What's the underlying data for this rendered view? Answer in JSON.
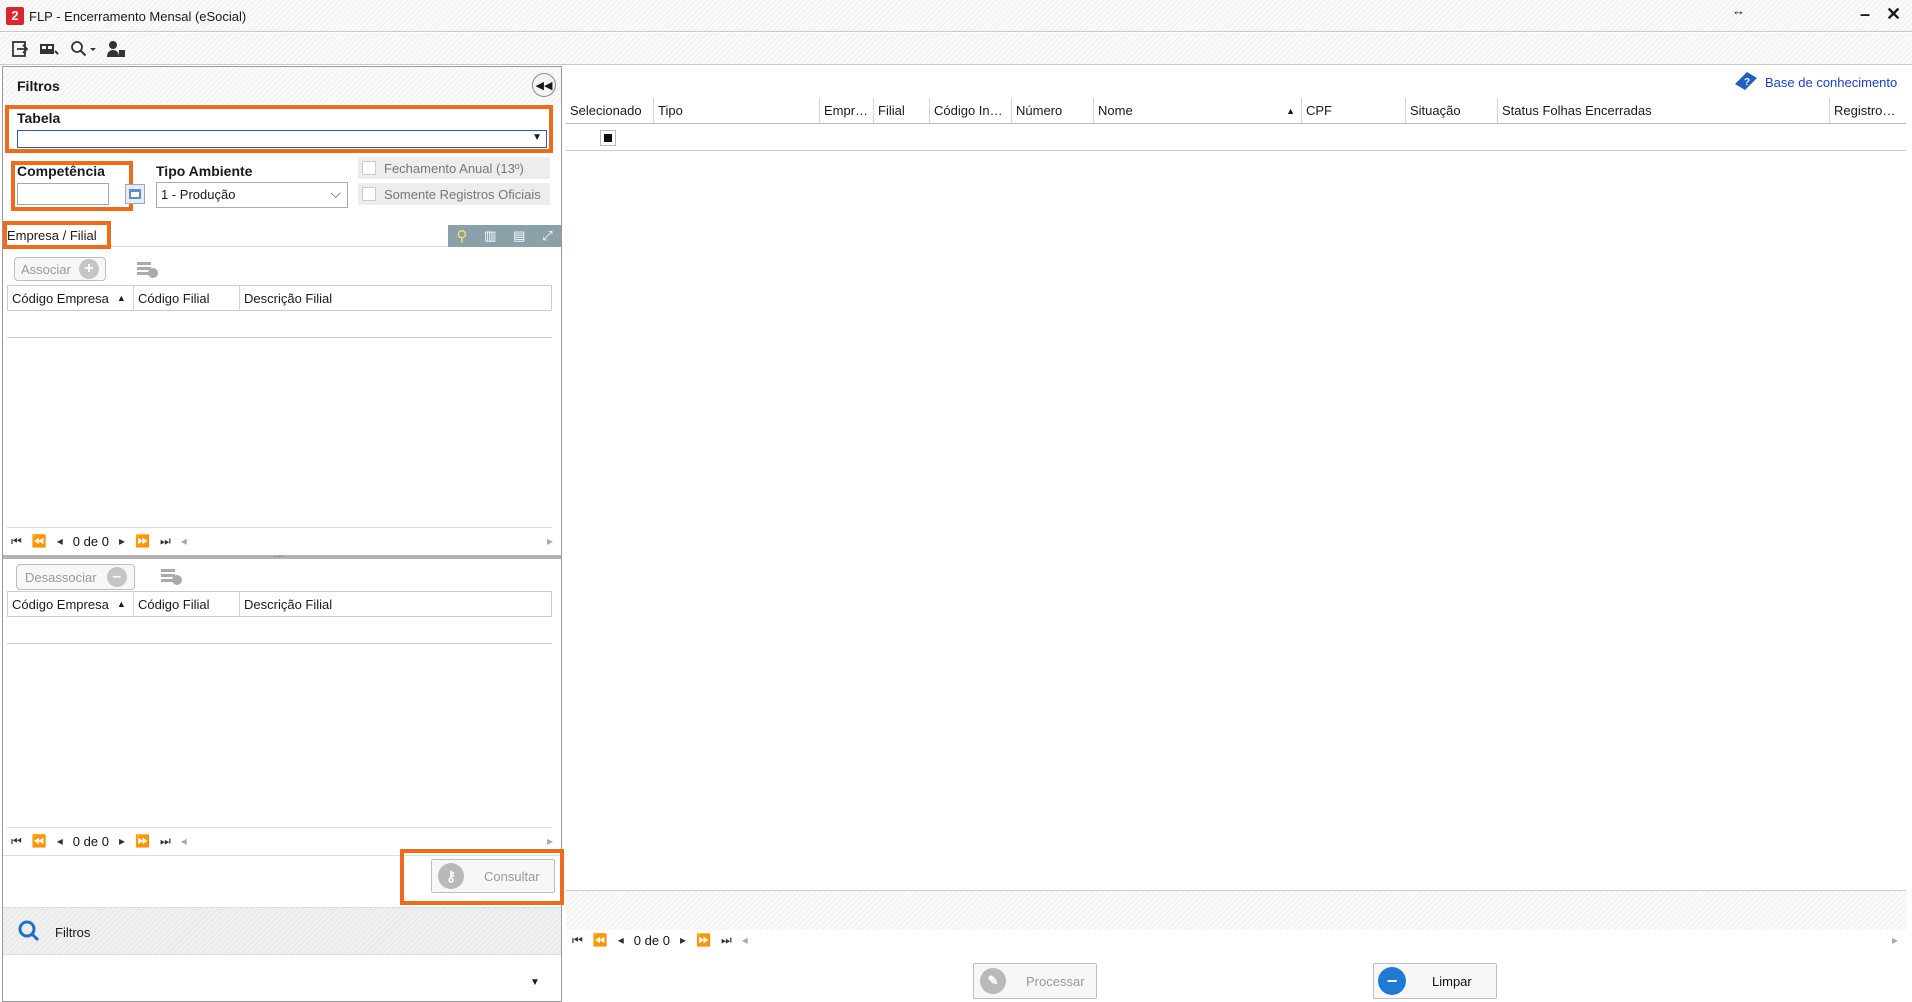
{
  "window": {
    "title": "FLP - Encerramento Mensal (eSocial)",
    "app_icon": "2",
    "resize_glyph": "↔",
    "minimize_glyph": "–",
    "close_glyph": "✕"
  },
  "toolbar": {
    "icons": [
      "exit-icon",
      "screen-icon",
      "search-icon",
      "user-icon"
    ]
  },
  "filters": {
    "panel_title": "Filtros",
    "tabela_label": "Tabela",
    "tabela_value": "",
    "competencia_label": "Competência",
    "competencia_value": "",
    "tipo_ambiente_label": "Tipo Ambiente",
    "tipo_ambiente_value": "1 - Produção",
    "fechamento_anual_label": "Fechamento Anual (13º)",
    "somente_registros_label": "Somente Registros Oficiais",
    "empresa_filial_label": "Empresa / Filial",
    "associar_label": "Associar",
    "desassociar_label": "Desassociar",
    "columns": [
      "Código Empresa",
      "Código Filial",
      "Descrição Filial"
    ],
    "pager_text": "0 de 0",
    "splitter_glyph": "....",
    "consultar_label": "Consultar",
    "footer_filtros_label": "Filtros"
  },
  "main": {
    "kb_link": "Base de conhecimento",
    "columns": [
      "Selecionado",
      "Tipo",
      "Empr…",
      "Filial",
      "Código In…",
      "Número",
      "Nome",
      "CPF",
      "Situação",
      "Status Folhas Encerradas",
      "Registro…"
    ],
    "pager_text": "0 de 0",
    "processar_label": "Processar",
    "limpar_label": "Limpar"
  },
  "colors": {
    "highlight": "#f06a1c",
    "link": "#1b3fc9",
    "limpar_icon": "#1f7ad6"
  }
}
